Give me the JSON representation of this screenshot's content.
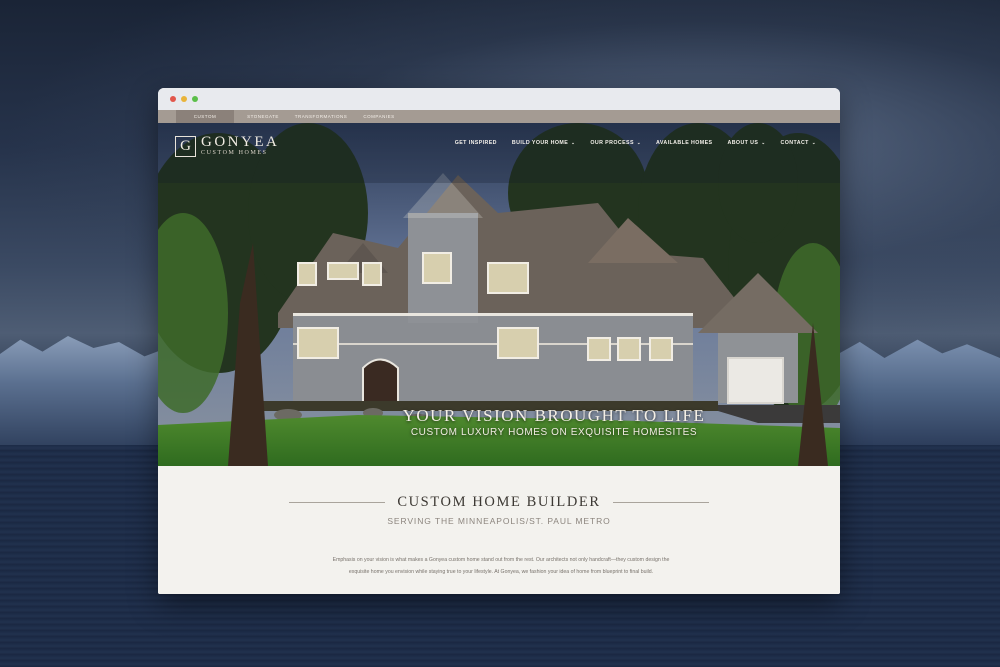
{
  "browser": {
    "controls": [
      "close",
      "minimize",
      "maximize"
    ]
  },
  "site_tabs": [
    {
      "label": "CUSTOM",
      "active": true
    },
    {
      "label": "STONEGATE",
      "active": false
    },
    {
      "label": "TRANSFORMATIONS",
      "active": false
    },
    {
      "label": "COMPANIES",
      "active": false
    }
  ],
  "logo": {
    "mark": "G",
    "name": "GONYEA",
    "subtitle": "CUSTOM HOMES"
  },
  "nav": [
    {
      "label": "GET INSPIRED",
      "has_dropdown": false
    },
    {
      "label": "BUILD YOUR HOME",
      "has_dropdown": true
    },
    {
      "label": "OUR PROCESS",
      "has_dropdown": true
    },
    {
      "label": "AVAILABLE HOMES",
      "has_dropdown": false
    },
    {
      "label": "ABOUT US",
      "has_dropdown": true
    },
    {
      "label": "CONTACT",
      "has_dropdown": true
    }
  ],
  "hero": {
    "headline": "YOUR VISION BROUGHT TO LIFE",
    "subheadline": "CUSTOM LUXURY HOMES ON EXQUISITE HOMESITES"
  },
  "intro": {
    "title": "CUSTOM HOME BUILDER",
    "subtitle": "SERVING THE MINNEAPOLIS/ST. PAUL METRO",
    "body": "Emphasis on your vision is what makes a Gonyea custom home stand out from the rest. Our architects not only handcraft—they custom design the exquisite home you envision while staying true to your lifestyle. At Gonyea, we fashion your idea of home from blueprint to final build."
  },
  "colors": {
    "tab_bar": "#a49b93",
    "tab_active": "#8b817a",
    "page_bg": "#f3f2ee",
    "title_text": "#3c3833"
  }
}
